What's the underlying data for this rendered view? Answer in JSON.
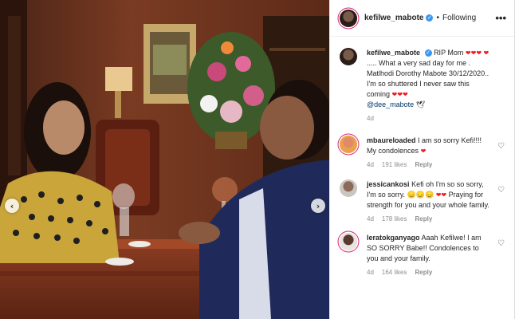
{
  "post": {
    "username": "kefilwe_mabote",
    "follow_status": "Following",
    "more_label": "•••"
  },
  "caption": {
    "username": "kefilwe_mabote",
    "line1": "RIP Mom",
    "hearts1": "❤❤❤",
    "heart2": "❤",
    "line2": "..... What a very sad day for me . Matlhodi Dorothy Mabote 30/12/2020.. I'm so shuttered I never saw this coming",
    "hearts3": "❤❤❤",
    "mention": "@dee_mabote",
    "trail": "🕊",
    "age": "4d"
  },
  "comments": [
    {
      "username": "mbaureloaded",
      "text": "I am so sorry Kefi!!!! My condolences",
      "hearts": "❤",
      "age": "4d",
      "likes": "191 likes",
      "reply": "Reply"
    },
    {
      "username": "jessicankosi",
      "text_a": "Kefi oh I'm so so sorry, I'm so sorry.",
      "emoji": "😞😞😞",
      "hearts": "❤❤",
      "text_b": "Praying for strength for you and your whole family.",
      "age": "4d",
      "likes": "178 likes",
      "reply": "Reply"
    },
    {
      "username": "leratokganyago",
      "text": "Aaah Kefilwe! I am SO SORRY Babe!! Condolences to you and your family.",
      "age": "4d",
      "likes": "164 likes",
      "reply": "Reply"
    }
  ],
  "icons": {
    "verified": "✓",
    "nav_left": "‹",
    "nav_right": "›",
    "heart_outline": "♡"
  },
  "colors": {
    "verified_blue": "#3897f0",
    "heart_red": "#ed1c24",
    "mention_blue": "#00376b",
    "meta_gray": "#8e8e8e"
  }
}
